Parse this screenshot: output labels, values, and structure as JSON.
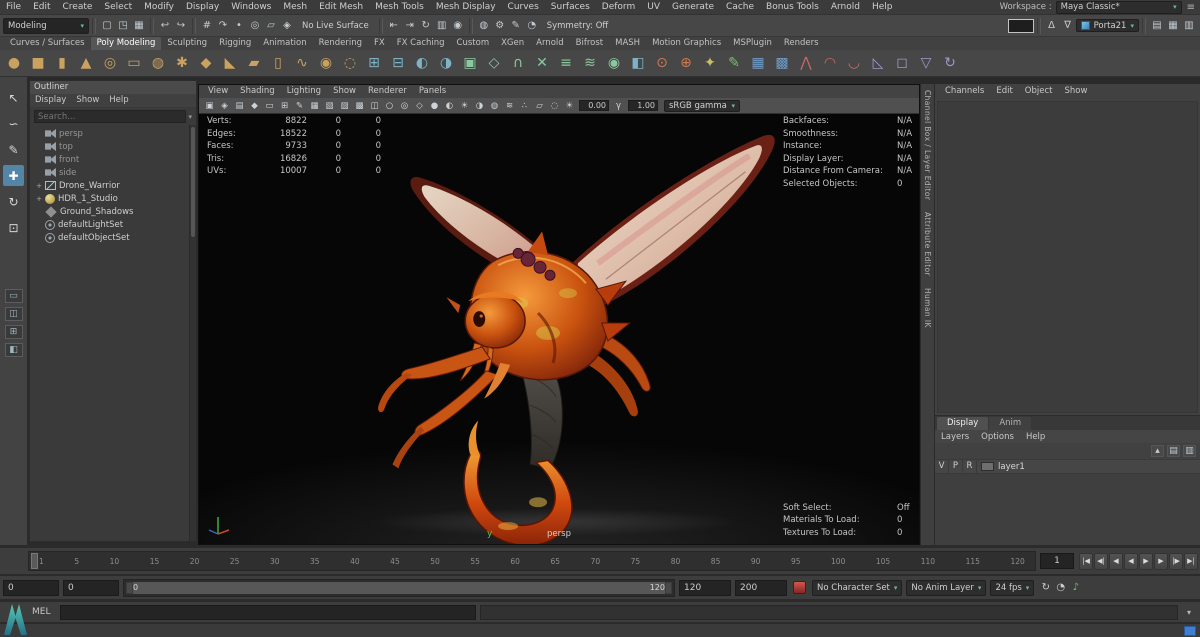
{
  "colors": {
    "accent": "#5285a6",
    "teal": "#69b7ae",
    "viewport_bg": "#0a0a0a",
    "panel": "#424242",
    "axis_green": "#4fd04f"
  },
  "menubar": {
    "items": [
      "File",
      "Edit",
      "Create",
      "Select",
      "Modify",
      "Display",
      "Windows",
      "Mesh",
      "Edit Mesh",
      "Mesh Tools",
      "Mesh Display",
      "Curves",
      "Surfaces",
      "Deform",
      "UV",
      "Generate",
      "Cache",
      "Bonus Tools",
      "Arnold",
      "Help"
    ],
    "workspace_label": "Workspace :",
    "workspace_value": "Maya Classic*"
  },
  "statusline": {
    "mode": "Modeling",
    "segments": [
      {
        "type": "icons",
        "items": [
          {
            "name": "new-scene-icon",
            "g": "▢"
          },
          {
            "name": "open-scene-icon",
            "g": "◳"
          },
          {
            "name": "save-scene-icon",
            "g": "▦"
          }
        ]
      },
      {
        "type": "icons",
        "items": [
          {
            "name": "undo-icon",
            "g": "↩"
          },
          {
            "name": "redo-icon",
            "g": "↪"
          }
        ]
      },
      {
        "type": "icons",
        "items": [
          {
            "name": "snap-to-grid-icon",
            "g": "#"
          },
          {
            "name": "snap-to-curve-icon",
            "g": "↷"
          },
          {
            "name": "snap-to-point-icon",
            "g": "•"
          },
          {
            "name": "snap-to-projected-center-icon",
            "g": "◎"
          },
          {
            "name": "snap-to-view-plane-icon",
            "g": "▱"
          },
          {
            "name": "make-object-live-icon",
            "g": "◈"
          }
        ]
      },
      {
        "type": "text",
        "name": "no-live-surface-label",
        "text": "No Live Surface"
      },
      {
        "type": "icons",
        "items": [
          {
            "name": "input-connections-icon",
            "g": "⇤"
          },
          {
            "name": "output-connections-icon",
            "g": "⇥"
          },
          {
            "name": "construction-history-icon",
            "g": "↻"
          },
          {
            "name": "render-view-icon",
            "g": "▥"
          },
          {
            "name": "render-frame-icon",
            "g": "◉"
          }
        ]
      },
      {
        "type": "icons",
        "items": [
          {
            "name": "ipr-render-icon",
            "g": "◍"
          },
          {
            "name": "render-settings-icon",
            "g": "⚙"
          },
          {
            "name": "paint-effects-icon",
            "g": "✎"
          },
          {
            "name": "hypershade-icon",
            "g": "◔"
          }
        ]
      },
      {
        "type": "text",
        "name": "symmetry-label",
        "text": "Symmetry: Off"
      },
      {
        "type": "spacer"
      },
      {
        "type": "field",
        "name": "quick-input-field",
        "value": ""
      },
      {
        "type": "icons",
        "items": [
          {
            "name": "absolute-transform-icon",
            "g": "Δ"
          },
          {
            "name": "relative-transform-icon",
            "g": "∇"
          }
        ]
      },
      {
        "type": "dropdown",
        "name": "selection-set-dropdown",
        "icon": "cube",
        "text": "Porta21"
      },
      {
        "type": "icons",
        "items": [
          {
            "name": "attribute-editor-toggle",
            "g": "▤"
          },
          {
            "name": "tool-settings-toggle",
            "g": "▦"
          },
          {
            "name": "channel-box-toggle",
            "g": "▥"
          }
        ]
      }
    ]
  },
  "shelf": {
    "tabs": [
      "Curves / Surfaces",
      "Poly Modeling",
      "Sculpting",
      "Rigging",
      "Animation",
      "Rendering",
      "FX",
      "FX Caching",
      "Custom",
      "XGen",
      "Arnold",
      "Bifrost",
      "MASH",
      "Motion Graphics",
      "MSPlugin",
      "Renders"
    ],
    "active_tab": "Poly Modeling",
    "icons": [
      {
        "name": "poly-sphere-icon",
        "g": "●",
        "c": "#c9a260"
      },
      {
        "name": "poly-cube-icon",
        "g": "■",
        "c": "#c9a260"
      },
      {
        "name": "poly-cylinder-icon",
        "g": "▮",
        "c": "#c9a260"
      },
      {
        "name": "poly-cone-icon",
        "g": "▲",
        "c": "#c9a260"
      },
      {
        "name": "poly-torus-icon",
        "g": "◎",
        "c": "#c9a260"
      },
      {
        "name": "poly-plane-icon",
        "g": "▭",
        "c": "#c9a260"
      },
      {
        "name": "poly-disc-icon",
        "g": "◍",
        "c": "#c9a260"
      },
      {
        "name": "poly-gear-icon",
        "g": "✱",
        "c": "#c9a260"
      },
      {
        "name": "poly-platonic-icon",
        "g": "◆",
        "c": "#c9a260"
      },
      {
        "name": "poly-pyramid-icon",
        "g": "◣",
        "c": "#c9a260"
      },
      {
        "name": "poly-prism-icon",
        "g": "▰",
        "c": "#c9a260"
      },
      {
        "name": "poly-pipe-icon",
        "g": "▯",
        "c": "#c9a260"
      },
      {
        "name": "poly-helix-icon",
        "g": "∿",
        "c": "#c9a260"
      },
      {
        "name": "poly-soccerball-icon",
        "g": "◉",
        "c": "#c9a260"
      },
      {
        "name": "poly-superellipse-icon",
        "g": "◌",
        "c": "#c9a260"
      },
      {
        "name": "combine-icon",
        "g": "⊞",
        "c": "#7fb2c4"
      },
      {
        "name": "separate-icon",
        "g": "⊟",
        "c": "#7fb2c4"
      },
      {
        "name": "boolean-union-icon",
        "g": "◐",
        "c": "#7fb2c4"
      },
      {
        "name": "boolean-difference-icon",
        "g": "◑",
        "c": "#7fb2c4"
      },
      {
        "name": "extrude-icon",
        "g": "▣",
        "c": "#8cc79e"
      },
      {
        "name": "bevel-icon",
        "g": "◇",
        "c": "#8cc79e"
      },
      {
        "name": "bridge-icon",
        "g": "∩",
        "c": "#8cc79e"
      },
      {
        "name": "multi-cut-icon",
        "g": "✕",
        "c": "#8cc79e"
      },
      {
        "name": "insert-edge-loop-icon",
        "g": "≡",
        "c": "#8cc79e"
      },
      {
        "name": "offset-edge-loop-icon",
        "g": "≋",
        "c": "#8cc79e"
      },
      {
        "name": "smooth-icon",
        "g": "◉",
        "c": "#8cc79e"
      },
      {
        "name": "mirror-icon",
        "g": "◧",
        "c": "#7fb2c4"
      },
      {
        "name": "target-weld-icon",
        "g": "⊙",
        "c": "#cc7a50"
      },
      {
        "name": "merge-vertices-icon",
        "g": "⊕",
        "c": "#cc7a50"
      },
      {
        "name": "sculpt-tool-icon",
        "g": "✦",
        "c": "#c9c060"
      },
      {
        "name": "quad-draw-icon",
        "g": "✎",
        "c": "#74c06a"
      },
      {
        "name": "create-uvs-icon",
        "g": "▦",
        "c": "#6f9cc9"
      },
      {
        "name": "uv-editor-icon",
        "g": "▩",
        "c": "#6f9cc9"
      },
      {
        "name": "normals-icon",
        "g": "⋀",
        "c": "#c96a6a"
      },
      {
        "name": "soften-edge-icon",
        "g": "◠",
        "c": "#c96a6a"
      },
      {
        "name": "harden-edge-icon",
        "g": "◡",
        "c": "#c96a6a"
      },
      {
        "name": "triangulate-icon",
        "g": "◺",
        "c": "#9a9ac9"
      },
      {
        "name": "quadrangulate-icon",
        "g": "◻",
        "c": "#9a9ac9"
      },
      {
        "name": "reduce-icon",
        "g": "▽",
        "c": "#9a9ac9"
      },
      {
        "name": "spin-edge-icon",
        "g": "↻",
        "c": "#9a9ac9"
      }
    ]
  },
  "toolbox": {
    "tools": [
      {
        "name": "select-tool",
        "g": "↖",
        "active": false
      },
      {
        "name": "lasso-select-tool",
        "g": "∽",
        "active": false
      },
      {
        "name": "paint-select-tool",
        "g": "✎",
        "active": false
      },
      {
        "name": "move-tool",
        "g": "✚",
        "active": true
      },
      {
        "name": "rotate-tool",
        "g": "↻",
        "active": false
      },
      {
        "name": "scale-tool",
        "g": "⊡",
        "active": false
      }
    ],
    "layouts": [
      {
        "name": "single-pane-layout-button",
        "g": "▭"
      },
      {
        "name": "two-pane-layout-button",
        "g": "◫"
      },
      {
        "name": "four-pane-layout-button",
        "g": "⊞"
      },
      {
        "name": "outliner-persp-layout-button",
        "g": "◧"
      }
    ]
  },
  "outliner": {
    "title": "Outliner",
    "menus": [
      "Display",
      "Show",
      "Help"
    ],
    "search_placeholder": "Search...",
    "items": [
      {
        "label": "persp",
        "type": "camera",
        "muted": true,
        "expandable": false
      },
      {
        "label": "top",
        "type": "camera",
        "muted": true,
        "expandable": false
      },
      {
        "label": "front",
        "type": "camera",
        "muted": true,
        "expandable": false
      },
      {
        "label": "side",
        "type": "camera",
        "muted": true,
        "expandable": false
      },
      {
        "label": "Drone_Warrior",
        "type": "transform",
        "muted": false,
        "expandable": true
      },
      {
        "label": "HDR_1_Studio",
        "type": "sphere",
        "muted": false,
        "expandable": true
      },
      {
        "label": "Ground_Shadows",
        "type": "shadow",
        "muted": false,
        "expandable": false
      },
      {
        "label": "defaultLightSet",
        "type": "set",
        "muted": false,
        "expandable": false
      },
      {
        "label": "defaultObjectSet",
        "type": "set",
        "muted": false,
        "expandable": false
      }
    ]
  },
  "viewport": {
    "menus": [
      "View",
      "Shading",
      "Lighting",
      "Show",
      "Renderer",
      "Panels"
    ],
    "toolbar_icons": [
      {
        "name": "select-camera-icon",
        "g": "▣"
      },
      {
        "name": "lock-camera-icon",
        "g": "◈"
      },
      {
        "name": "camera-attributes-icon",
        "g": "▤"
      },
      {
        "name": "bookmarks-icon",
        "g": "◆"
      },
      {
        "name": "image-plane-icon",
        "g": "▭"
      },
      {
        "name": "pan-zoom-icon",
        "g": "⊞"
      },
      {
        "name": "grease-pencil-icon",
        "g": "✎"
      },
      {
        "name": "grid-icon",
        "g": "▦"
      },
      {
        "name": "film-gate-icon",
        "g": "▧"
      },
      {
        "name": "resolution-gate-icon",
        "g": "▨"
      },
      {
        "name": "gate-mask-icon",
        "g": "▩"
      },
      {
        "name": "field-chart-icon",
        "g": "◫"
      },
      {
        "name": "safe-action-icon",
        "g": "○"
      },
      {
        "name": "safe-title-icon",
        "g": "◎"
      },
      {
        "name": "wireframe-icon",
        "g": "◇"
      },
      {
        "name": "shaded-icon",
        "g": "●"
      },
      {
        "name": "textured-icon",
        "g": "◐"
      },
      {
        "name": "lights-icon",
        "g": "☀"
      },
      {
        "name": "shadows-icon",
        "g": "◑"
      },
      {
        "name": "ao-icon",
        "g": "◍"
      },
      {
        "name": "motion-blur-icon",
        "g": "≋"
      },
      {
        "name": "multisample-icon",
        "g": "∴"
      },
      {
        "name": "xray-icon",
        "g": "▱"
      },
      {
        "name": "isolate-select-icon",
        "g": "◌"
      }
    ],
    "exposure_icon": "☀",
    "gamma_icon": "γ",
    "exposure": "0.00",
    "gamma": "1.00",
    "color_transform": "sRGB gamma",
    "camera_label": "persp",
    "axis_label": "y",
    "hud_left": [
      {
        "label": "Verts:",
        "total": "8822",
        "c2": "0",
        "c3": "0"
      },
      {
        "label": "Edges:",
        "total": "18522",
        "c2": "0",
        "c3": "0"
      },
      {
        "label": "Faces:",
        "total": "9733",
        "c2": "0",
        "c3": "0"
      },
      {
        "label": "Tris:",
        "total": "16826",
        "c2": "0",
        "c3": "0"
      },
      {
        "label": "UVs:",
        "total": "10007",
        "c2": "0",
        "c3": "0"
      }
    ],
    "hud_right": [
      {
        "label": "Backfaces:",
        "value": "N/A"
      },
      {
        "label": "Smoothness:",
        "value": "N/A"
      },
      {
        "label": "Instance:",
        "value": "N/A"
      },
      {
        "label": "Display Layer:",
        "value": "N/A"
      },
      {
        "label": "Distance From Camera:",
        "value": "N/A"
      },
      {
        "label": "Selected Objects:",
        "value": "0"
      }
    ],
    "hud_bottom": [
      {
        "label": "Soft Select:",
        "value": "Off"
      },
      {
        "label": "Materials To Load:",
        "value": "0"
      },
      {
        "label": "Textures To Load:",
        "value": "0"
      }
    ]
  },
  "right_tabs": [
    {
      "label": "Channel Box / Layer Editor"
    },
    {
      "label": "Attribute Editor"
    },
    {
      "label": "Human IK"
    }
  ],
  "channelbox": {
    "menus": [
      "Channels",
      "Edit",
      "Object",
      "Show"
    ]
  },
  "layer_editor": {
    "tabs": [
      "Display",
      "Anim"
    ],
    "active_tab": "Display",
    "menus": [
      "Layers",
      "Options",
      "Help"
    ],
    "toolbar_icons": [
      {
        "name": "move-layer-up-icon",
        "g": "▴"
      },
      {
        "name": "new-empty-layer-icon",
        "g": "▤"
      },
      {
        "name": "new-layer-from-selected-icon",
        "g": "▥"
      }
    ],
    "rows": [
      {
        "v": "V",
        "p": "P",
        "r": "R",
        "name": "layer1"
      }
    ]
  },
  "timeline": {
    "ticks": [
      "1",
      "5",
      "10",
      "15",
      "20",
      "25",
      "30",
      "35",
      "40",
      "45",
      "50",
      "55",
      "60",
      "65",
      "70",
      "75",
      "80",
      "85",
      "90",
      "95",
      "100",
      "105",
      "110",
      "115",
      "120"
    ],
    "current_frame": "1",
    "transport": [
      {
        "name": "go-to-start-button",
        "g": "|◀"
      },
      {
        "name": "step-back-key-button",
        "g": "◀|"
      },
      {
        "name": "step-back-frame-button",
        "g": "◀"
      },
      {
        "name": "play-backwards-button",
        "g": "◀"
      },
      {
        "name": "play-forwards-button",
        "g": "▶"
      },
      {
        "name": "step-forward-frame-button",
        "g": "▶"
      },
      {
        "name": "step-forward-key-button",
        "g": "|▶"
      },
      {
        "name": "go-to-end-button",
        "g": "▶|"
      }
    ]
  },
  "range_slider": {
    "anim_start": "0",
    "playback_start": "0",
    "bar_start_label": "0",
    "bar_end_label": "120",
    "playback_end": "120",
    "anim_end": "200",
    "character_set": "No Character Set",
    "anim_layer": "No Anim Layer",
    "fps": "24 fps",
    "trailing_icons": [
      {
        "name": "playback-loop-icon",
        "g": "↻",
        "green": false
      },
      {
        "name": "auto-key-icon",
        "g": "◔",
        "green": false
      },
      {
        "name": "audio-icon",
        "g": "♪",
        "green": true
      }
    ]
  },
  "command_line": {
    "label": "MEL"
  },
  "help_line": {
    "text": ""
  }
}
